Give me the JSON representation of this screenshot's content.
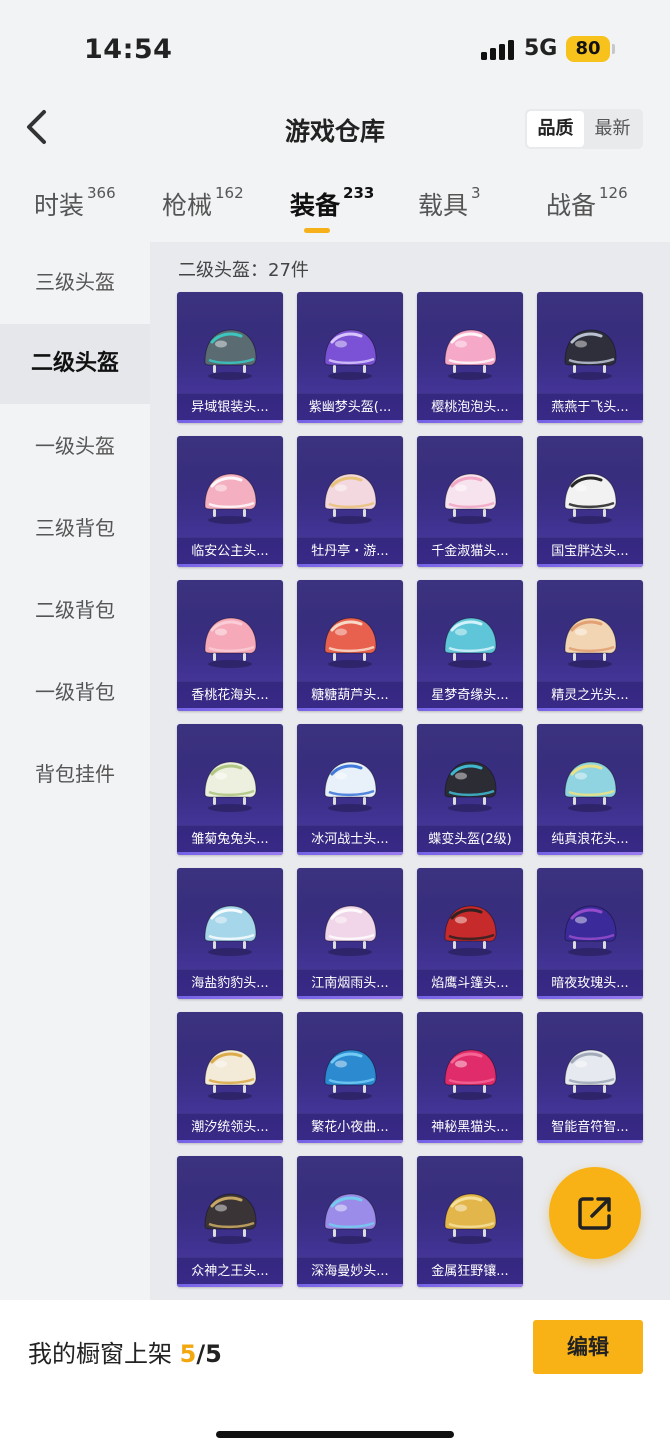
{
  "status_bar": {
    "time": "14:54",
    "network": "5G",
    "battery": "80"
  },
  "header": {
    "title": "游戏仓库",
    "sort_options": [
      "品质",
      "最新"
    ]
  },
  "tabs": [
    {
      "label": "时装",
      "count": "366"
    },
    {
      "label": "枪械",
      "count": "162"
    },
    {
      "label": "装备",
      "count": "233"
    },
    {
      "label": "载具",
      "count": "3"
    },
    {
      "label": "战备",
      "count": "126"
    }
  ],
  "sidebar": [
    {
      "label": "三级头盔"
    },
    {
      "label": "二级头盔"
    },
    {
      "label": "一级头盔"
    },
    {
      "label": "三级背包"
    },
    {
      "label": "二级背包"
    },
    {
      "label": "一级背包"
    },
    {
      "label": "背包挂件"
    }
  ],
  "section": {
    "title": "二级头盔：27件"
  },
  "items": [
    {
      "name": "异域银装头...",
      "icon": "helmet-icon",
      "color": "#5a6b72",
      "accent": "#38d0c8"
    },
    {
      "name": "紫幽梦头盔(...",
      "icon": "helmet-icon",
      "color": "#7b52d6",
      "accent": "#e0d0ff"
    },
    {
      "name": "樱桃泡泡头...",
      "icon": "helmet-icon",
      "color": "#f6a8c8",
      "accent": "#ffffff"
    },
    {
      "name": "燕燕于飞头...",
      "icon": "helmet-icon",
      "color": "#2e2f3a",
      "accent": "#c9d0e0"
    },
    {
      "name": "临安公主头...",
      "icon": "helmet-icon",
      "color": "#f4b0c0",
      "accent": "#ffffff"
    },
    {
      "name": "牡丹亭・游...",
      "icon": "helmet-icon",
      "color": "#f3d8df",
      "accent": "#e8c070"
    },
    {
      "name": "千金淑猫头...",
      "icon": "helmet-icon",
      "color": "#f7e3ee",
      "accent": "#f0a0c0"
    },
    {
      "name": "国宝胖达头...",
      "icon": "helmet-icon",
      "color": "#f2f2f2",
      "accent": "#111111"
    },
    {
      "name": "香桃花海头...",
      "icon": "helmet-icon",
      "color": "#f6a9b9",
      "accent": "#fbd0da"
    },
    {
      "name": "糖糖葫芦头...",
      "icon": "helmet-icon",
      "color": "#e8604e",
      "accent": "#f7e7d4"
    },
    {
      "name": "星梦奇缘头...",
      "icon": "helmet-icon",
      "color": "#5ec6d8",
      "accent": "#dff5ff"
    },
    {
      "name": "精灵之光头...",
      "icon": "helmet-icon",
      "color": "#f2d6b4",
      "accent": "#e09a6c"
    },
    {
      "name": "雏菊兔兔头...",
      "icon": "helmet-icon",
      "color": "#eef0df",
      "accent": "#a9c27a"
    },
    {
      "name": "冰河战士头...",
      "icon": "helmet-icon",
      "color": "#e8f0fa",
      "accent": "#2e6bd6"
    },
    {
      "name": "蝶变头盔(2级)",
      "icon": "helmet-icon",
      "color": "#2c2c34",
      "accent": "#42c6e0"
    },
    {
      "name": "纯真浪花头...",
      "icon": "helmet-icon",
      "color": "#8fd4e0",
      "accent": "#f4e27a"
    },
    {
      "name": "海盐豹豹头...",
      "icon": "helmet-icon",
      "color": "#a6d6ea",
      "accent": "#ffffff"
    },
    {
      "name": "江南烟雨头...",
      "icon": "helmet-icon",
      "color": "#f0d6e8",
      "accent": "#ffffff"
    },
    {
      "name": "焰鹰斗篷头...",
      "icon": "helmet-icon",
      "color": "#c62a2a",
      "accent": "#202020"
    },
    {
      "name": "暗夜玫瑰头...",
      "icon": "helmet-icon",
      "color": "#3a2a9a",
      "accent": "#a050d0"
    },
    {
      "name": "潮汐统领头...",
      "icon": "helmet-icon",
      "color": "#f3ead8",
      "accent": "#d8a43a"
    },
    {
      "name": "繁花小夜曲...",
      "icon": "helmet-icon",
      "color": "#2b8ad0",
      "accent": "#7ad0f8"
    },
    {
      "name": "神秘黑猫头...",
      "icon": "helmet-icon",
      "color": "#e02c6a",
      "accent": "#f66a9a"
    },
    {
      "name": "智能音符智...",
      "icon": "helmet-icon",
      "color": "#e6e9ef",
      "accent": "#9aa3b3"
    },
    {
      "name": "众神之王头...",
      "icon": "helmet-icon",
      "color": "#3a3436",
      "accent": "#d8b46a"
    },
    {
      "name": "深海曼妙头...",
      "icon": "helmet-icon",
      "color": "#9a8ce8",
      "accent": "#6fd2f0"
    },
    {
      "name": "金属狂野镶...",
      "icon": "helmet-icon",
      "color": "#e2b64a",
      "accent": "#f7e4a2"
    }
  ],
  "fab": {
    "icon": "share-icon"
  },
  "bottom_bar": {
    "showcase_label": "我的橱窗上架",
    "current": "5",
    "total": "/5",
    "edit_label": "编辑"
  },
  "colors": {
    "accent": "#f8b215",
    "card_bg": "#3b2f88"
  }
}
